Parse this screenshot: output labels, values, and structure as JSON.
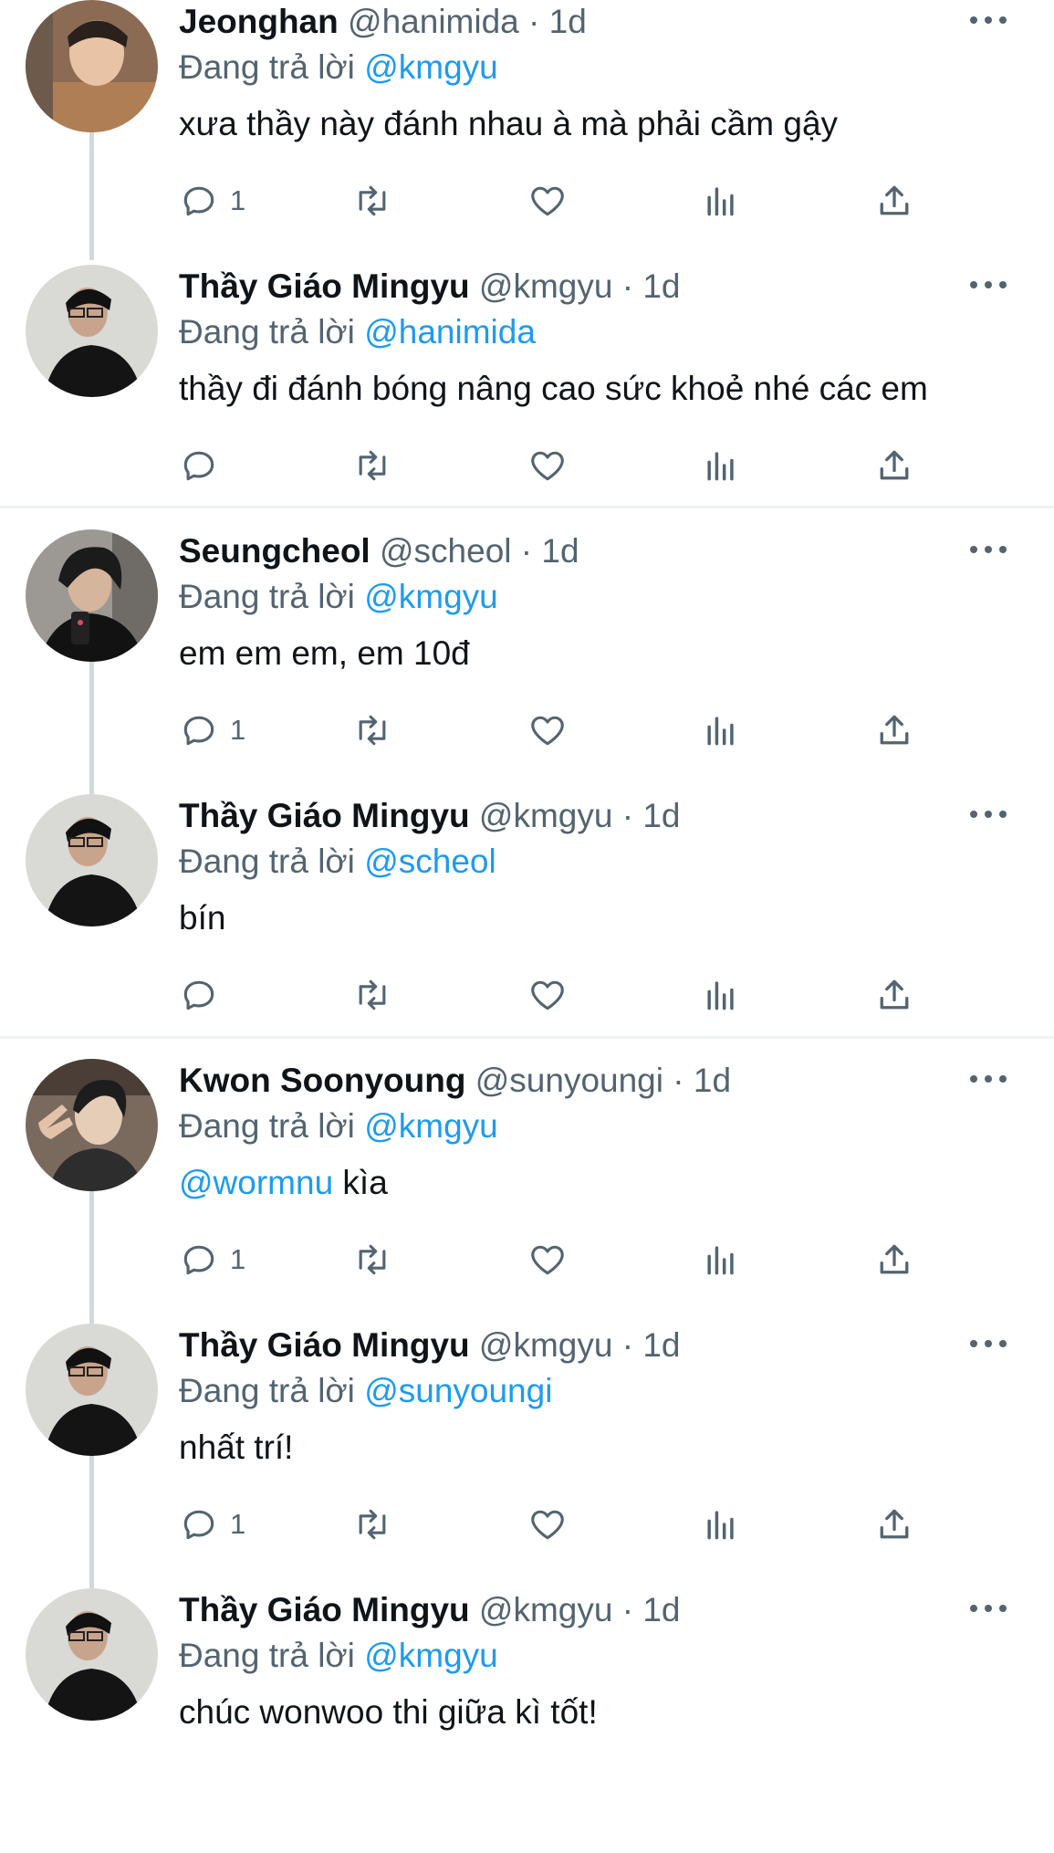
{
  "replying_prefix": "Đang trả lời",
  "tweets": [
    {
      "name": "Jeonghan",
      "handle": "@hanimida",
      "sep": "·",
      "time": "1d",
      "reply_to": "@kmgyu",
      "text": "xưa thầy này đánh nhau à mà phải cầm gậy",
      "reply_count": "1",
      "avatar": "avatar-jeonghan"
    },
    {
      "name": "Thầy Giáo Mingyu",
      "handle": "@kmgyu",
      "sep": "·",
      "time": "1d",
      "reply_to": "@hanimida",
      "text": "thầy đi đánh bóng nâng cao sức khoẻ nhé các em",
      "reply_count": "",
      "avatar": "avatar-mingyu"
    },
    {
      "name": "Seungcheol",
      "handle": "@scheol",
      "sep": "·",
      "time": "1d",
      "reply_to": "@kmgyu",
      "text": "em em em, em 10đ",
      "reply_count": "1",
      "avatar": "avatar-seungcheol"
    },
    {
      "name": "Thầy Giáo Mingyu",
      "handle": "@kmgyu",
      "sep": "·",
      "time": "1d",
      "reply_to": "@scheol",
      "text": "bín",
      "reply_count": "",
      "avatar": "avatar-mingyu"
    },
    {
      "name": "Kwon Soonyoung",
      "handle": "@sunyoungi",
      "sep": "·",
      "time": "1d",
      "reply_to": "@kmgyu",
      "text_mention": "@wormnu",
      "text": " kìa",
      "reply_count": "1",
      "avatar": "avatar-soonyoung"
    },
    {
      "name": "Thầy Giáo Mingyu",
      "handle": "@kmgyu",
      "sep": "·",
      "time": "1d",
      "reply_to": "@sunyoungi",
      "text": "nhất trí!",
      "reply_count": "1",
      "avatar": "avatar-mingyu"
    },
    {
      "name": "Thầy Giáo Mingyu",
      "handle": "@kmgyu",
      "sep": "·",
      "time": "1d",
      "reply_to": "@kmgyu",
      "text": "chúc wonwoo thi giữa kì tốt!",
      "reply_count": "",
      "avatar": "avatar-mingyu"
    }
  ],
  "icons": {
    "reply": "reply-icon",
    "retweet": "retweet-icon",
    "like": "heart-icon",
    "views": "views-icon",
    "share": "share-icon",
    "more": "more-icon"
  },
  "colors": {
    "link": "#1d9bf0",
    "muted": "#536471",
    "text": "#0f1419",
    "divider": "#eff3f4"
  }
}
